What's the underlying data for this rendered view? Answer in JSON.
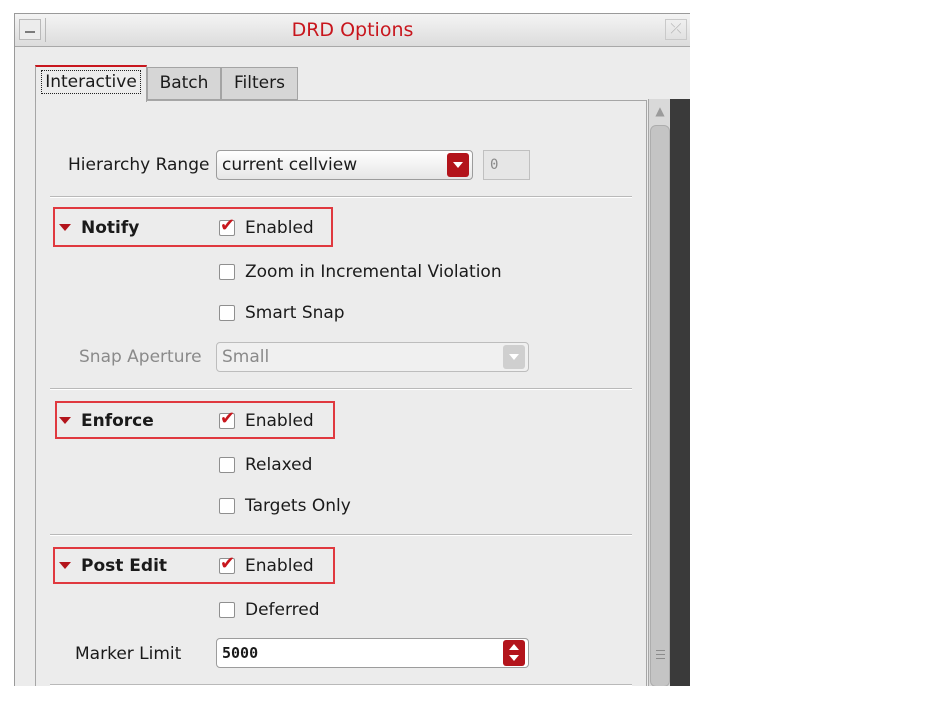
{
  "window": {
    "title": "DRD Options",
    "close_glyph": "⤫"
  },
  "tabs": [
    {
      "label": "Interactive",
      "active": true
    },
    {
      "label": "Batch",
      "active": false
    },
    {
      "label": "Filters",
      "active": false
    }
  ],
  "hierarchy": {
    "label": "Hierarchy Range",
    "value": "current cellview",
    "depth": "0"
  },
  "notify": {
    "title": "Notify",
    "enabled_label": "Enabled",
    "enabled": true,
    "zoom_label": "Zoom in Incremental Violation",
    "zoom": false,
    "smart_snap_label": "Smart Snap",
    "smart_snap": false,
    "snap_aperture_label": "Snap Aperture",
    "snap_aperture_value": "Small"
  },
  "enforce": {
    "title": "Enforce",
    "enabled_label": "Enabled",
    "enabled": true,
    "relaxed_label": "Relaxed",
    "relaxed": false,
    "targets_label": "Targets Only",
    "targets_only": false
  },
  "post_edit": {
    "title": "Post Edit",
    "enabled_label": "Enabled",
    "enabled": true,
    "deferred_label": "Deferred",
    "deferred": false,
    "marker_limit_label": "Marker Limit",
    "marker_limit": "5000"
  },
  "colors": {
    "accent": "#c8161d",
    "highlight": "#e0393f",
    "control_red": "#b3141b"
  }
}
